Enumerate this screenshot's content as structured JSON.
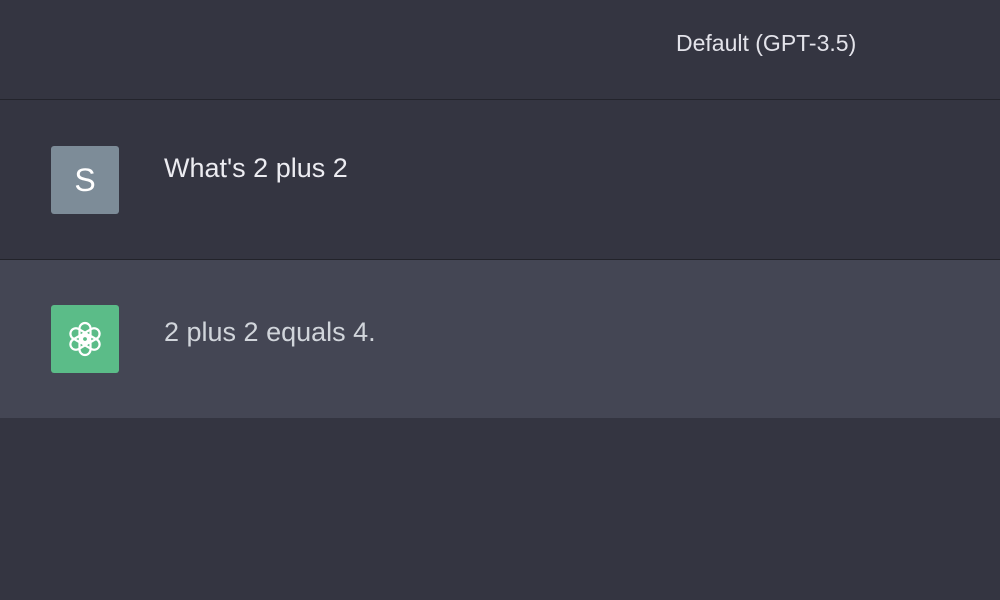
{
  "header": {
    "model_label": "Default (GPT-3.5)"
  },
  "conversation": {
    "messages": [
      {
        "role": "user",
        "avatar_letter": "S",
        "avatar_color": "#7d8c98",
        "text": "What's 2 plus 2"
      },
      {
        "role": "assistant",
        "avatar_icon": "openai-logo-icon",
        "avatar_color": "#5bbc88",
        "text": "2 plus 2 equals 4."
      }
    ]
  },
  "colors": {
    "background": "#343541",
    "assistant_row": "#444654"
  }
}
